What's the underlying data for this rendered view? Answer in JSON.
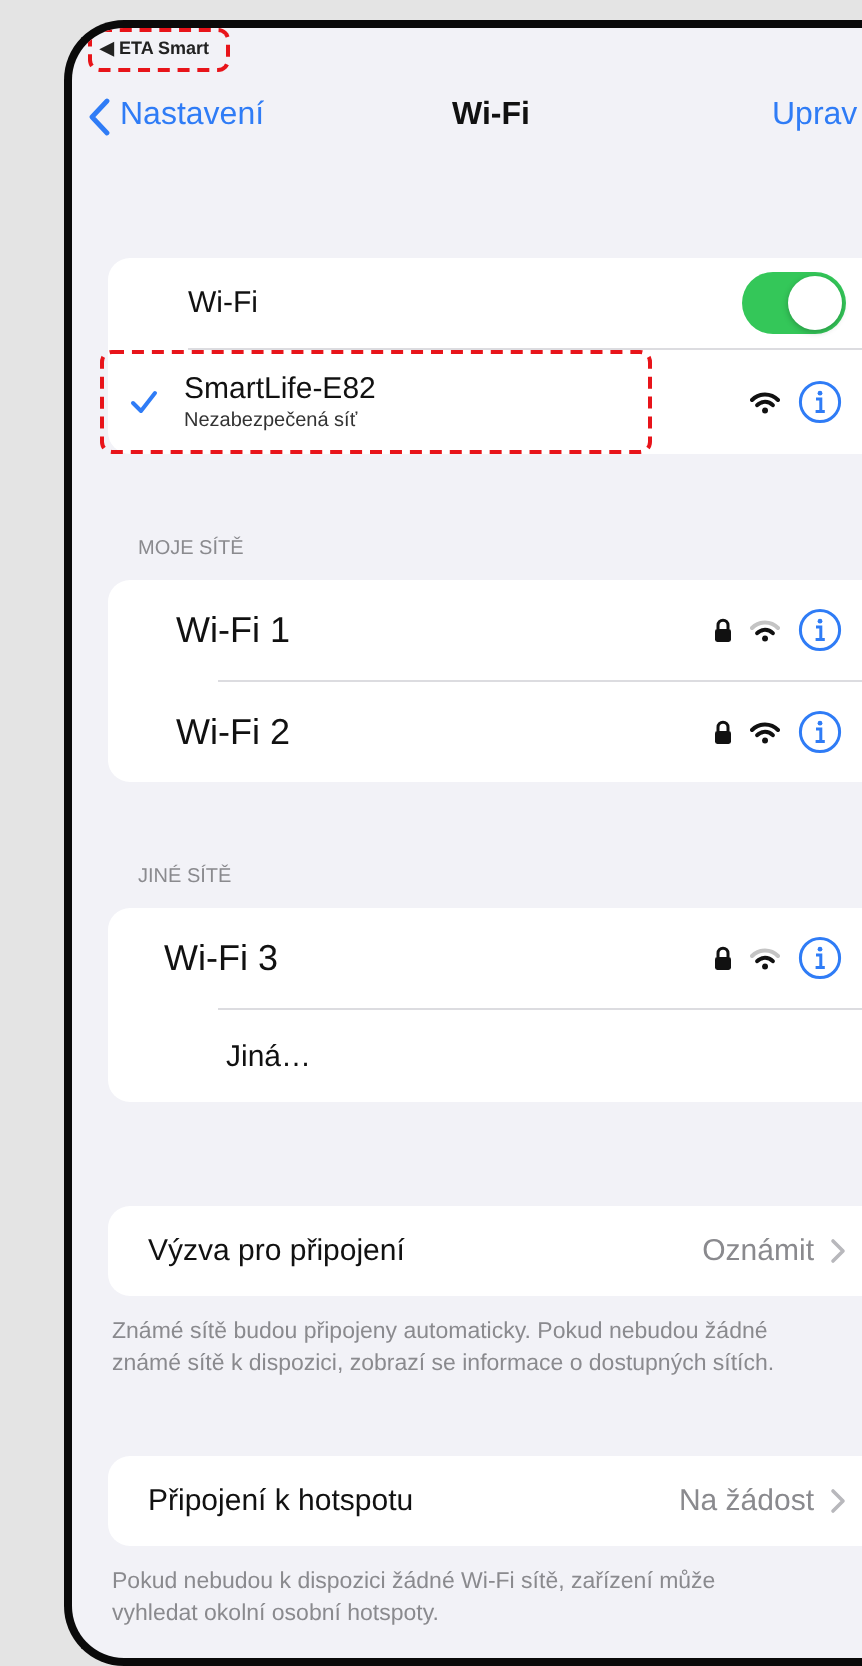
{
  "status_bar": {
    "back_app": "◀ ETA Smart",
    "highlighted": true
  },
  "nav": {
    "back": "Nastavení",
    "title": "Wi-Fi",
    "action": "Uprav"
  },
  "wifi_toggle": {
    "label": "Wi-Fi",
    "on": true
  },
  "current_network": {
    "name": "SmartLife-E82",
    "subtitle": "Nezabezpečená síť",
    "connected": true,
    "secured": false,
    "signal_full": true,
    "highlighted": true
  },
  "sections": [
    {
      "header": "MOJE SÍTĚ",
      "networks": [
        {
          "name": "Wi-Fi 1",
          "secured": true,
          "signal_full": false
        },
        {
          "name": "Wi-Fi 2",
          "secured": true,
          "signal_full": true
        }
      ]
    },
    {
      "header": "JINÉ SÍTĚ",
      "networks": [
        {
          "name": "Wi-Fi 3",
          "secured": true,
          "signal_full": false
        }
      ],
      "other": "Jiná…"
    }
  ],
  "settings": [
    {
      "label": "Výzva pro připojení",
      "value": "Oznámit",
      "footer": "Známé sítě budou připojeny automaticky. Pokud nebudou žádné známé sítě k dispozici, zobrazí se informace o dostupných sítích."
    },
    {
      "label": "Připojení k hotspotu",
      "value": "Na žádost",
      "footer": "Pokud nebudou k dispozici žádné Wi-Fi sítě, zařízení může vyhledat okolní osobní hotspoty."
    }
  ]
}
